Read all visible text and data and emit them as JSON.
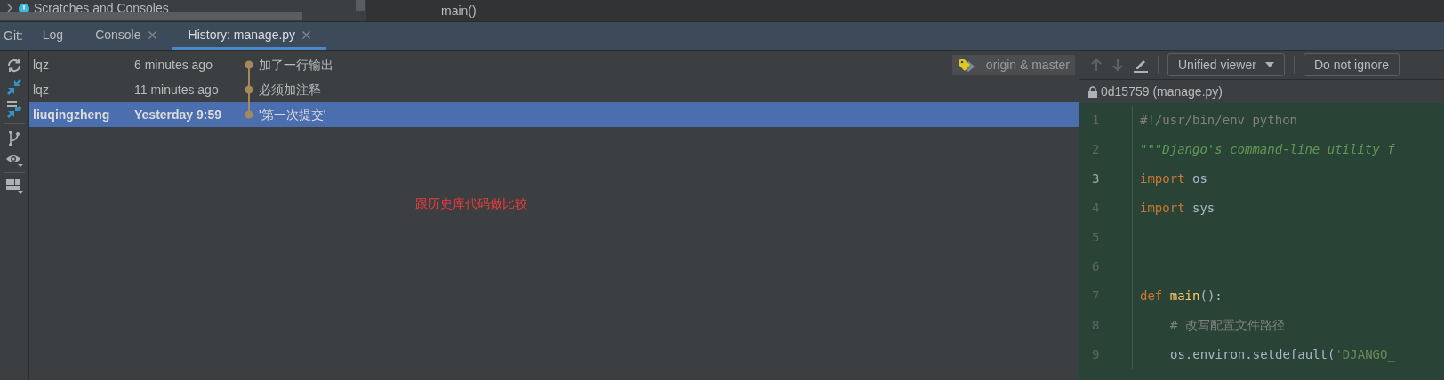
{
  "project_tree": {
    "item": "Scratches and Consoles"
  },
  "editor_breadcrumb": "main()",
  "tool_window": {
    "title": "Git:",
    "tabs": [
      {
        "label": "Log",
        "selected": false,
        "closable": false
      },
      {
        "label": "Console",
        "selected": false,
        "closable": true
      },
      {
        "label": "History: manage.py",
        "selected": true,
        "closable": true
      }
    ]
  },
  "commits": [
    {
      "author": "lqz",
      "time": "6 minutes ago",
      "message": "加了一行输出",
      "selected": false,
      "refs": "origin & master"
    },
    {
      "author": "lqz",
      "time": "11 minutes ago",
      "message": "必须加注释",
      "selected": false
    },
    {
      "author": "liuqingzheng",
      "time": "Yesterday 9:59",
      "message": "'第一次提交'",
      "selected": true
    }
  ],
  "annotation": "跟历史库代码做比较",
  "diff_toolbar": {
    "viewer": "Unified viewer",
    "whitespace": "Do not ignore"
  },
  "file_header": "0d15759 (manage.py)",
  "code_lines": [
    {
      "number": "1",
      "current": false,
      "indented": false,
      "tokens": [
        {
          "kind": "comment",
          "text": "#!/usr/bin/env python"
        }
      ]
    },
    {
      "number": "2",
      "current": false,
      "indented": false,
      "tokens": [
        {
          "kind": "docstring",
          "text": "\"\"\"Django's command-line utility f"
        }
      ]
    },
    {
      "number": "3",
      "current": true,
      "indented": false,
      "tokens": [
        {
          "kind": "keyword",
          "text": "import"
        },
        {
          "kind": "plain",
          "text": " os"
        }
      ]
    },
    {
      "number": "4",
      "current": false,
      "indented": false,
      "tokens": [
        {
          "kind": "keyword",
          "text": "import"
        },
        {
          "kind": "plain",
          "text": " sys"
        }
      ]
    },
    {
      "number": "5",
      "current": false
    },
    {
      "number": "6",
      "current": false
    },
    {
      "number": "7",
      "current": false,
      "indented": false,
      "tokens": [
        {
          "kind": "keyword",
          "text": "def"
        },
        {
          "kind": "function",
          "text": " main"
        },
        {
          "kind": "plain",
          "text": "():"
        }
      ]
    },
    {
      "number": "8",
      "current": false,
      "indented": true,
      "tokens": [
        {
          "kind": "comment",
          "text": "# 改写配置文件路径"
        }
      ]
    },
    {
      "number": "9",
      "current": false,
      "indented": true,
      "tokens": [
        {
          "kind": "plain",
          "text": "os.environ.setdefault("
        },
        {
          "kind": "string",
          "text": "'DJANGO_"
        }
      ]
    }
  ]
}
